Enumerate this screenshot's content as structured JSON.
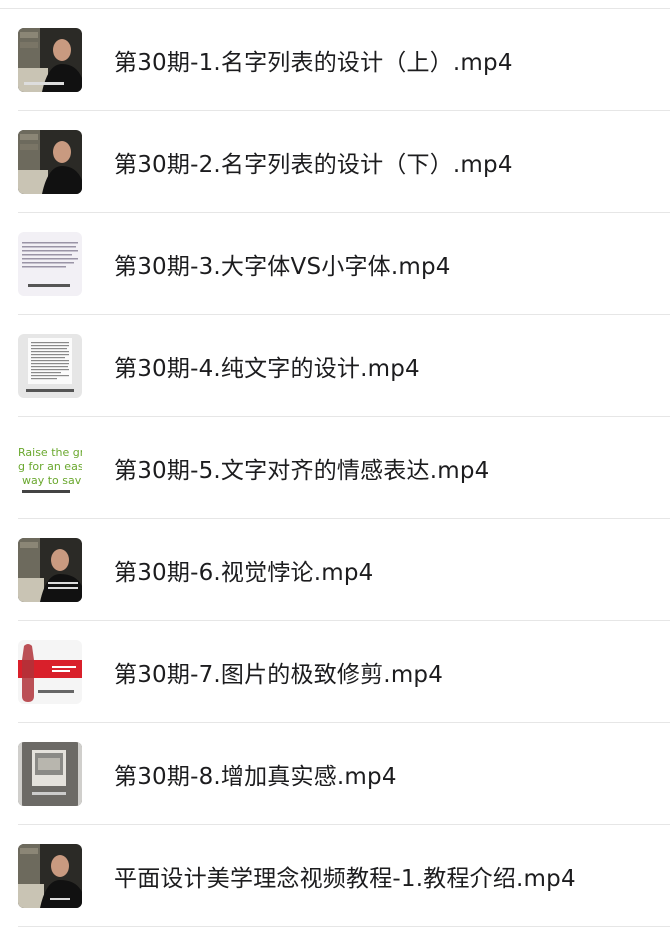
{
  "files": [
    {
      "name": "第30期-1.名字列表的设计（上）.mp4",
      "thumb": "video-presenter-thumbnail"
    },
    {
      "name": "第30期-2.名字列表的设计（下）.mp4",
      "thumb": "video-presenter-thumbnail"
    },
    {
      "name": "第30期-3.大字体VS小字体.mp4",
      "thumb": "text-page-thumbnail"
    },
    {
      "name": "第30期-4.纯文字的设计.mp4",
      "thumb": "document-page-thumbnail"
    },
    {
      "name": "第30期-5.文字对齐的情感表达.mp4",
      "thumb": "ad-text-thumbnail"
    },
    {
      "name": "第30期-6.视觉悖论.mp4",
      "thumb": "video-presenter-thumbnail"
    },
    {
      "name": "第30期-7.图片的极致修剪.mp4",
      "thumb": "coca-cola-ad-thumbnail"
    },
    {
      "name": "第30期-8.增加真实感.mp4",
      "thumb": "framed-photo-thumbnail"
    },
    {
      "name": "平面设计美学理念视频教程-1.教程介绍.mp4",
      "thumb": "video-presenter-thumbnail"
    }
  ],
  "thumbnail_text": {
    "ad_line1": "Raise the gre",
    "ad_line2": "g for an easy",
    "ad_line3": "way to sav"
  }
}
